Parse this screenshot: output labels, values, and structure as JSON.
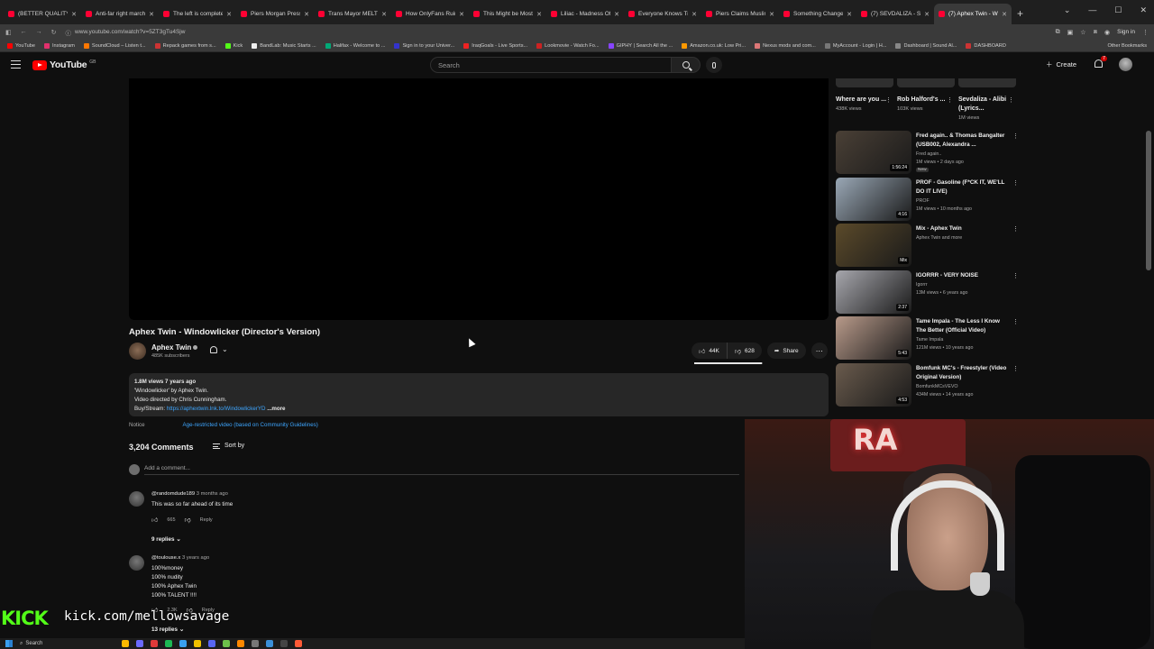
{
  "browser": {
    "tabs": [
      {
        "label": "(BETTER QUALITY) Li"
      },
      {
        "label": "Anti-far right march"
      },
      {
        "label": "The left is completely"
      },
      {
        "label": "Piers Morgan Presses"
      },
      {
        "label": "Trans Mayor MELTS D"
      },
      {
        "label": "How OnlyFans Ruined"
      },
      {
        "label": "This Might be Most In"
      },
      {
        "label": "Liliac - Madness Offic"
      },
      {
        "label": "Everyone Knows Trou"
      },
      {
        "label": "Piers Claims Muslims"
      },
      {
        "label": "Something Changed /"
      },
      {
        "label": "(7) SEVDALIZA - SHA"
      },
      {
        "label": "(7) Aphex Twin - Wind"
      }
    ],
    "new_tab": "+",
    "url": "www.youtube.com/watch?v=5ZT3gTu4Sjw",
    "signin": "Sign in",
    "bookmarks": [
      "YouTube",
      "Instagram",
      "SoundCloud – Listen t...",
      "Repack games from s...",
      "Kick",
      "BandLab: Music Starts ...",
      "Halifax - Welcome to ...",
      "Sign in to your Univer...",
      "IraqGoals - Live Sports...",
      "Lookmovie - Watch Fo...",
      "GIPHY | Search All the ...",
      "Amazon.co.uk: Low Pri...",
      "Nexus mods and com...",
      "MyAccount - Login | H...",
      "Dashboard | Sound Al...",
      "DASHBOARD"
    ],
    "other_bookmarks": "Other Bookmarks"
  },
  "yt": {
    "logo": "YouTube",
    "logo_country": "GB",
    "search_placeholder": "Search",
    "create": "Create",
    "notif_count": "7"
  },
  "video": {
    "title": "Aphex Twin - Windowlicker (Director's Version)",
    "channel": "Aphex Twin",
    "subscribers": "485K subscribers",
    "likes": "44K",
    "dislikes": "628",
    "share": "Share",
    "like_ratio": 0.985,
    "description": {
      "meta": "1.8M views  7 years ago",
      "line1": "'Windowlicker' by Aphex Twin.",
      "line2": "Video directed by Chris Cunningham.",
      "buy_prefix": "Buy/Stream: ",
      "link": "https://aphextwin.lnk.to/WindowlickerYD",
      "more": " ...more"
    },
    "notice_label": "Notice",
    "notice_value": "Age-restricted video (based on Community Guidelines)"
  },
  "comments": {
    "count": "3,204 Comments",
    "sort": "Sort by",
    "add_placeholder": "Add a comment...",
    "items": [
      {
        "user": "@randomdude189",
        "time": "3 months ago",
        "text": "This was so far ahead of its time",
        "likes": "665",
        "reply": "Reply",
        "replies": "9 replies"
      },
      {
        "user": "@toulouse.x",
        "time": "3 years ago",
        "text": "100%money\n100% nudity\n100% Aphex Twin\n100% TALENT !!!!",
        "likes": "2.3K",
        "reply": "Reply",
        "replies": "13 replies"
      }
    ]
  },
  "shorts": [
    {
      "title": "Where are you ...",
      "views": "438K views"
    },
    {
      "title": "Rob Halford's ...",
      "views": "103K views"
    },
    {
      "title": "Sevdaliza - Alibi (Lyrics...",
      "views": "1M views"
    }
  ],
  "recommendations": [
    {
      "title": "Fred again.. & Thomas Bangalter (USB002, Alexandra ...",
      "channel": "Fred again..",
      "meta": "1M views • 2 days ago",
      "badge": "New",
      "duration": "1:56:24",
      "color": "#4a4036"
    },
    {
      "title": "PROF - Gasoline (F*CK IT, WE'LL DO IT LIVE)",
      "channel": "PROF",
      "meta": "1M views • 10 months ago",
      "badge": "",
      "duration": "4:16",
      "color": "#9aa8b6"
    },
    {
      "title": "Mix - Aphex Twin",
      "channel": "Aphex Twin and more",
      "meta": "",
      "badge": "",
      "duration": "Mix",
      "color": "#5b4a2a"
    },
    {
      "title": "IGORRR - VERY NOISE",
      "channel": "Igorrr",
      "meta": "13M views • 6 years ago",
      "badge": "",
      "duration": "2:37",
      "color": "#a7a7ad"
    },
    {
      "title": "Tame Impala - The Less I Know The Better (Official Video)",
      "channel": "Tame Impala",
      "meta": "121M views • 10 years ago",
      "badge": "",
      "duration": "5:43",
      "color": "#b89a8a"
    },
    {
      "title": "Bomfunk MC's - Freestyler (Video Original Version)",
      "channel": "BomfunkMCsVEVO",
      "meta": "434M views • 14 years ago",
      "badge": "",
      "duration": "4:53",
      "color": "#6a5b4d"
    }
  ],
  "webcam": {
    "sign": "RA"
  },
  "kick": {
    "logo": "KICK",
    "url": "kick.com/mellowsavage"
  },
  "taskbar": {
    "search": "Search"
  }
}
